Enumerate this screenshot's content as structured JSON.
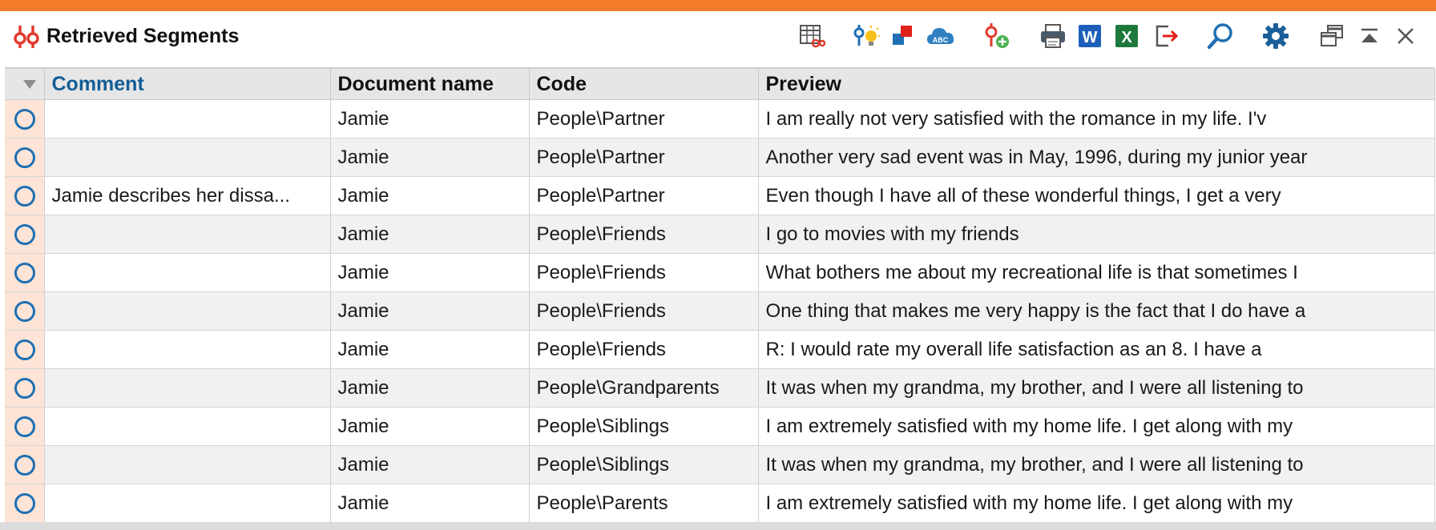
{
  "window": {
    "title": "Retrieved Segments",
    "accent_color": "#f47d2b"
  },
  "toolbar": {
    "icons": [
      "code-matrix-icon",
      "smart-coding-icon",
      "color-codes-icon",
      "word-cloud-icon",
      "add-code-icon",
      "print-icon",
      "export-word-icon",
      "export-excel-icon",
      "export-icon",
      "search-icon",
      "settings-icon",
      "undock-window-icon",
      "collapse-icon",
      "close-icon"
    ],
    "word_label": "W",
    "excel_label": "X",
    "wordcloud_label": "ABC"
  },
  "table": {
    "columns": [
      "Comment",
      "Document name",
      "Code",
      "Preview"
    ],
    "sorted_column": "Comment",
    "rows": [
      {
        "comment": "",
        "document": "Jamie",
        "code": "People\\Partner",
        "preview": "I am really not very satisfied with the romance in my life. I'v"
      },
      {
        "comment": "",
        "document": "Jamie",
        "code": "People\\Partner",
        "preview": "Another very sad event was in May, 1996, during my junior year"
      },
      {
        "comment": "Jamie describes her dissa...",
        "document": "Jamie",
        "code": "People\\Partner",
        "preview": "Even though I have all of these wonderful things, I get a very"
      },
      {
        "comment": "",
        "document": "Jamie",
        "code": "People\\Friends",
        "preview": "I go to movies with my friends"
      },
      {
        "comment": "",
        "document": "Jamie",
        "code": "People\\Friends",
        "preview": "What bothers me about my recreational life is that sometimes I"
      },
      {
        "comment": "",
        "document": "Jamie",
        "code": "People\\Friends",
        "preview": "One thing that makes me very happy is the fact that I do have a"
      },
      {
        "comment": "",
        "document": "Jamie",
        "code": "People\\Friends",
        "preview": "R: I would rate my overall life satisfaction as an 8. I have a"
      },
      {
        "comment": "",
        "document": "Jamie",
        "code": "People\\Grandparents",
        "preview": "It was when my grandma, my brother, and I were all listening to"
      },
      {
        "comment": "",
        "document": "Jamie",
        "code": "People\\Siblings",
        "preview": "I am extremely satisfied with my home life. I get along with my"
      },
      {
        "comment": "",
        "document": "Jamie",
        "code": "People\\Siblings",
        "preview": "It was when my grandma, my brother, and I were all listening to"
      },
      {
        "comment": "",
        "document": "Jamie",
        "code": "People\\Parents",
        "preview": "I am extremely satisfied with my home life. I get along with my"
      }
    ]
  }
}
